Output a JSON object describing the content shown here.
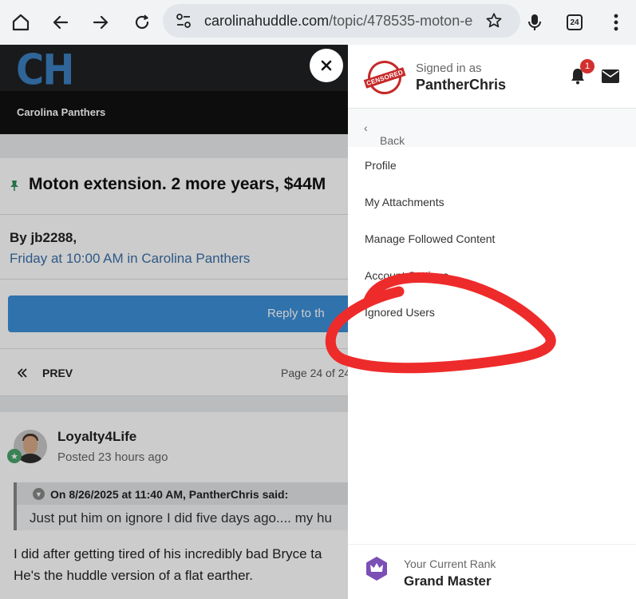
{
  "browser": {
    "url_host": "carolinahuddle.com",
    "url_path": "/topic/478535-moton-e",
    "tab_count": "24"
  },
  "site": {
    "logo": "CH",
    "nav_label": "Carolina Panthers"
  },
  "topic": {
    "title": "Moton extension. 2 more years, $44M",
    "by": "By jb2288,",
    "date": "Friday at 10:00 AM in Carolina Panthers",
    "reply_label": "Reply to th",
    "prev_label": "PREV",
    "page_of": "Page 24 of 24"
  },
  "post": {
    "author": "Loyalty4Life",
    "posted": "Posted 23 hours ago",
    "quote_header": "On 8/26/2025 at 11:40 AM, PantherChris said:",
    "quote_body": "Just put him on ignore I did five days ago.... my hu",
    "line1": "I did after getting tired of his incredibly bad Bryce ta",
    "line2": "He's the huddle version of a flat earther."
  },
  "drawer": {
    "signed_in_label": "Signed in as",
    "username": "PantherChris",
    "avatar_text": "CENSORED",
    "notification_count": "1",
    "back_label": "Back",
    "menu": [
      {
        "label": "Profile"
      },
      {
        "label": "My Attachments"
      },
      {
        "label": "Manage Followed Content"
      },
      {
        "label": "Account Settings"
      },
      {
        "label": "Ignored Users"
      }
    ],
    "rank_label": "Your Current Rank",
    "rank_value": "Grand Master"
  },
  "colors": {
    "accent": "#3d8fd8",
    "annotation": "#ee2b2b",
    "badge": "#d32f2f"
  }
}
